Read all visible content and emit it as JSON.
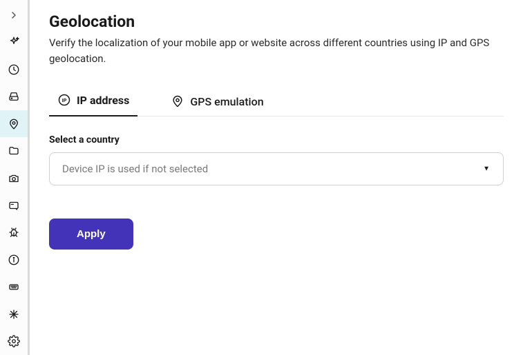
{
  "page": {
    "title": "Geolocation",
    "subtitle": "Verify the localization of your mobile app or website across different countries using IP and GPS geolocation."
  },
  "tabs": {
    "ip": {
      "label": "IP address"
    },
    "gps": {
      "label": "GPS emulation"
    }
  },
  "form": {
    "country_label": "Select a country",
    "country_placeholder": "Device IP is used if not selected",
    "apply_label": "Apply"
  },
  "sidebar": {
    "expand": "expand",
    "sparkle": "sparkle",
    "clock": "clock",
    "storage": "storage",
    "location": "location",
    "folder": "folder",
    "camera": "camera",
    "card": "card",
    "bug": "bug",
    "info": "info",
    "keyboard": "keyboard",
    "network": "network",
    "settings": "settings"
  }
}
